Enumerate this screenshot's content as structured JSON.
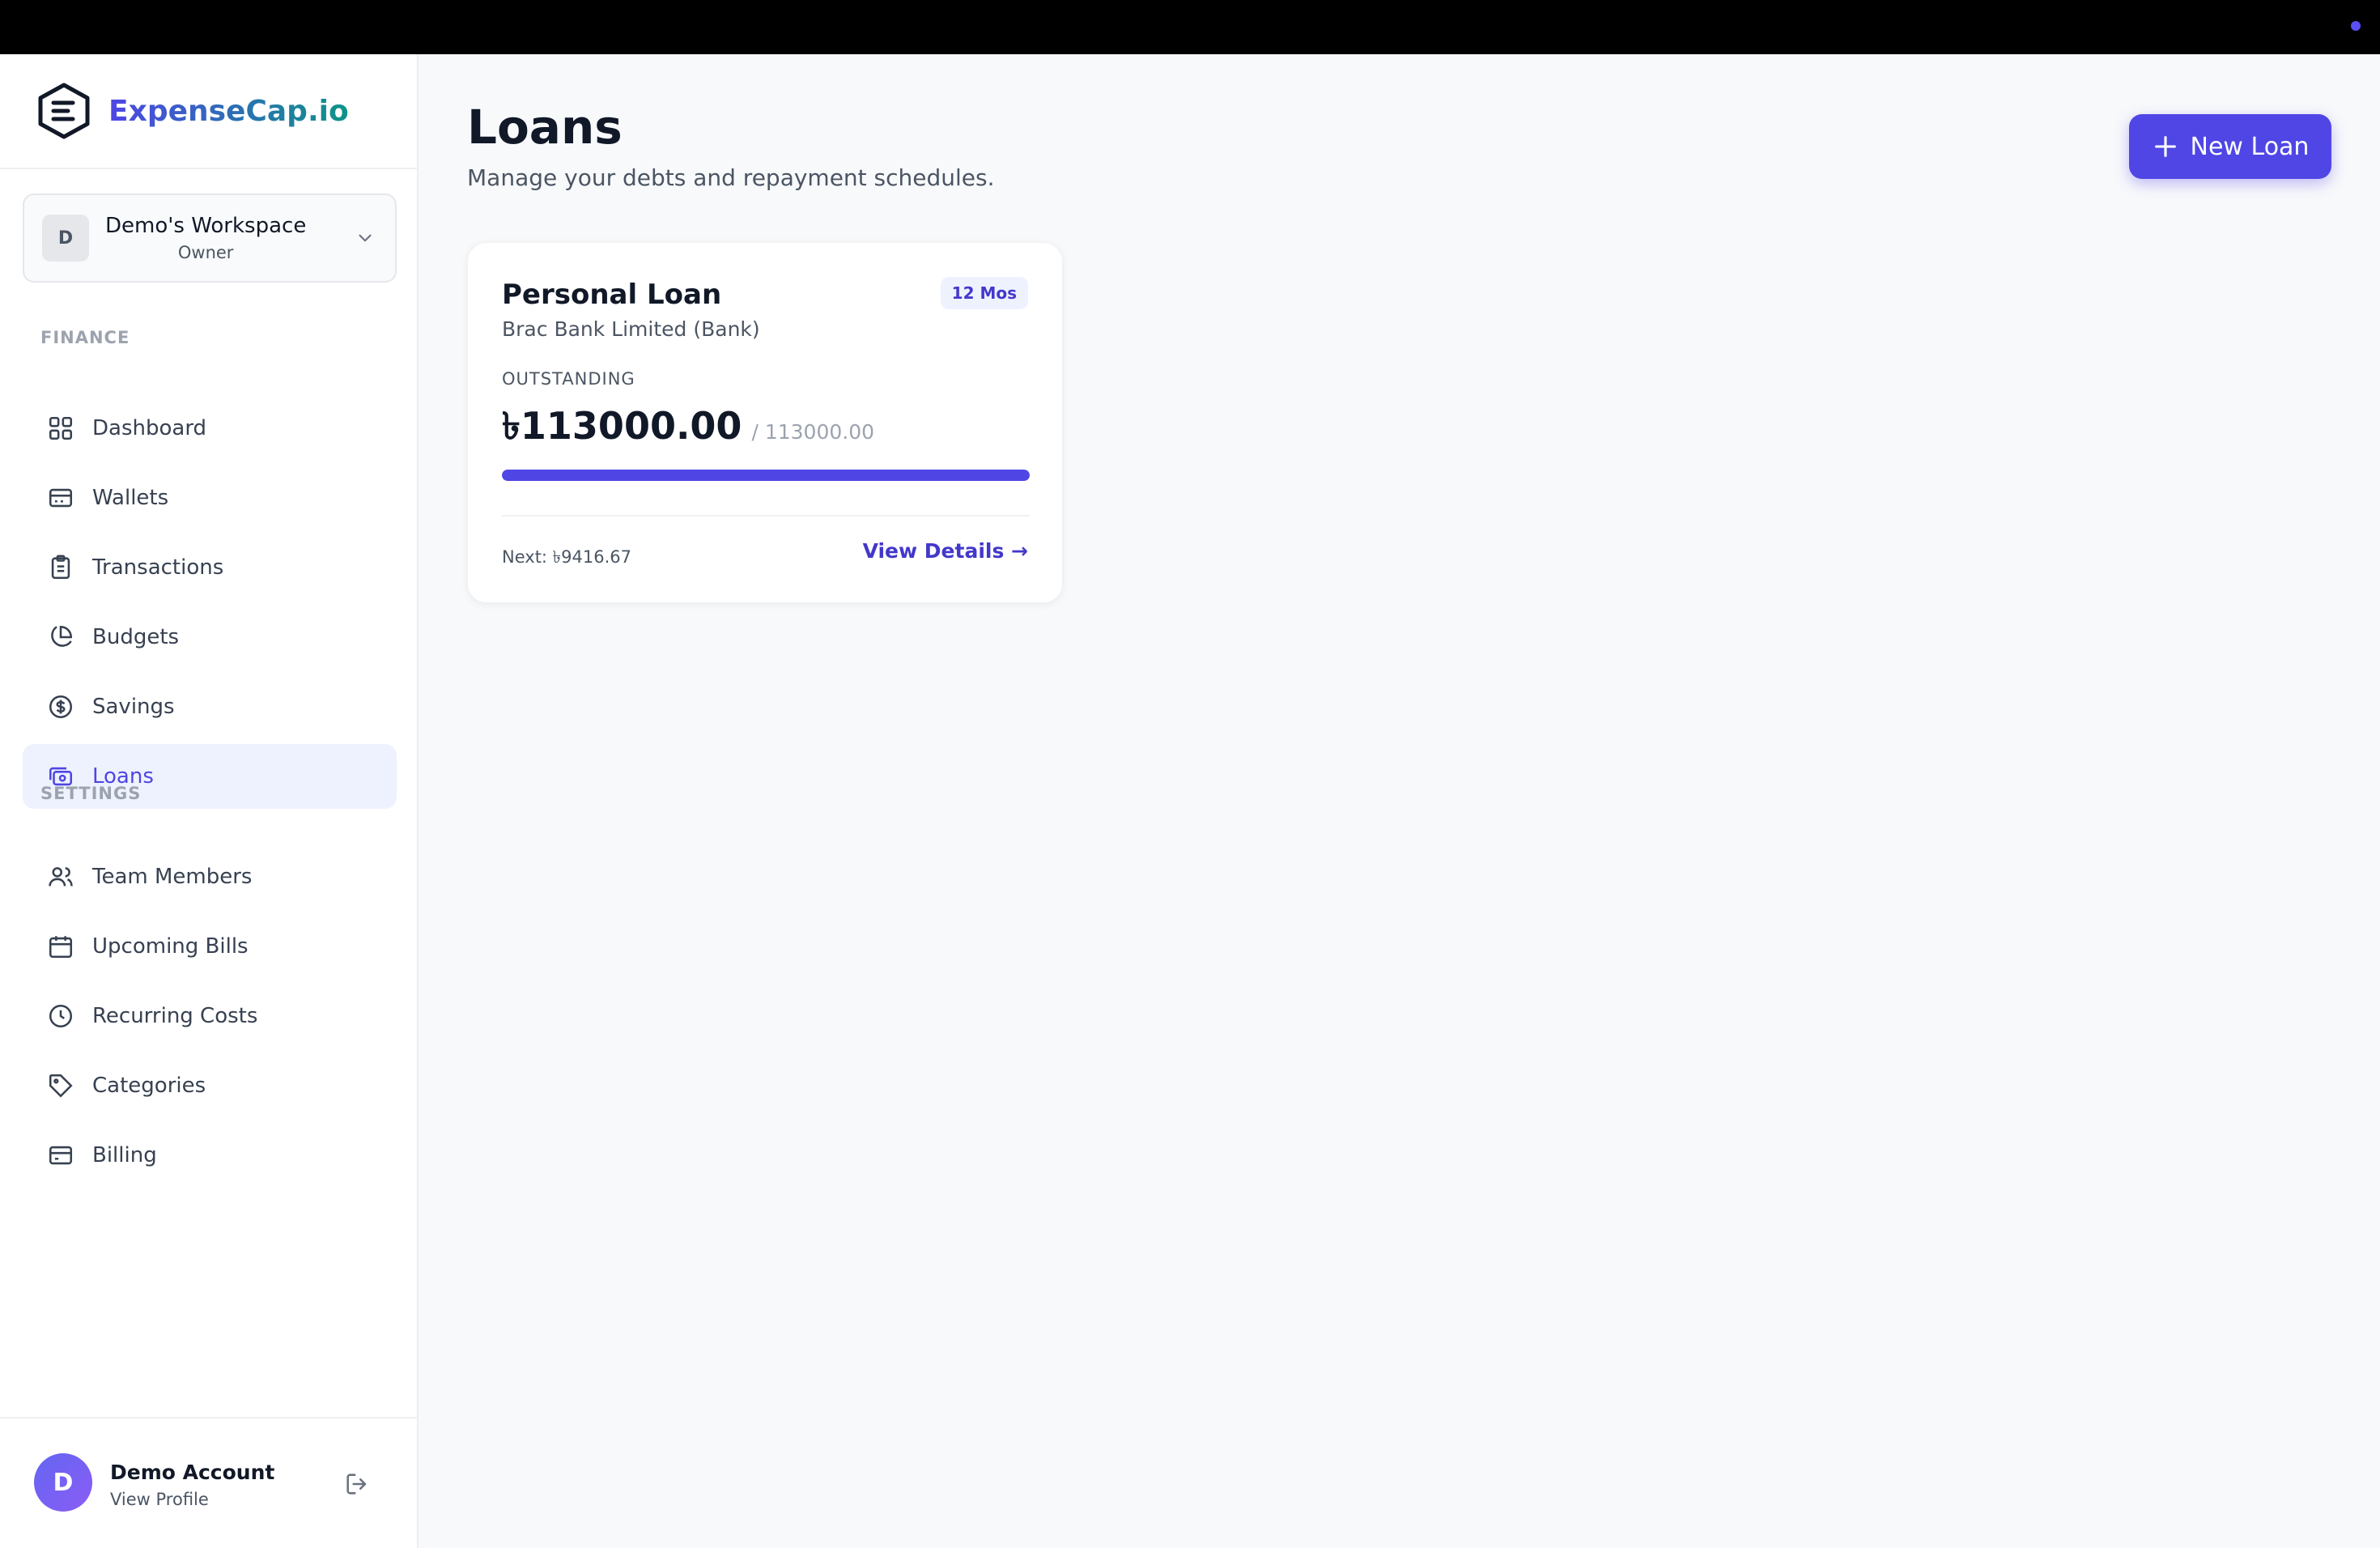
{
  "app": {
    "name": "ExpenseCap.io",
    "accent": "#4f46e5"
  },
  "workspace": {
    "initial": "D",
    "name": "Demo's Workspace",
    "role": "Owner"
  },
  "nav": {
    "finance_label": "FINANCE",
    "settings_label": "SETTINGS",
    "finance": [
      {
        "label": "Dashboard",
        "icon": "grid-icon"
      },
      {
        "label": "Wallets",
        "icon": "wallet-icon"
      },
      {
        "label": "Transactions",
        "icon": "clipboard-icon"
      },
      {
        "label": "Budgets",
        "icon": "pie-chart-icon"
      },
      {
        "label": "Savings",
        "icon": "dollar-circle-icon"
      },
      {
        "label": "Loans",
        "icon": "banknote-icon",
        "active": true
      }
    ],
    "settings": [
      {
        "label": "Team Members",
        "icon": "users-icon"
      },
      {
        "label": "Upcoming Bills",
        "icon": "calendar-icon"
      },
      {
        "label": "Recurring Costs",
        "icon": "clock-icon"
      },
      {
        "label": "Categories",
        "icon": "tag-icon"
      },
      {
        "label": "Billing",
        "icon": "credit-card-icon"
      }
    ]
  },
  "profile": {
    "initial": "D",
    "name": "Demo Account",
    "sub": "View Profile"
  },
  "page": {
    "title": "Loans",
    "subtitle": "Manage your debts and repayment schedules.",
    "new_button": "New Loan"
  },
  "loans": [
    {
      "title": "Personal Loan",
      "lender": "Brac Bank Limited (Bank)",
      "term_badge": "12 Mos",
      "outstanding_label": "OUTSTANDING",
      "outstanding": "৳113000.00",
      "total": "/ 113000.00",
      "progress_fraction": 1.0,
      "next": "Next: ৳9416.67",
      "details_label": "View Details →"
    }
  ]
}
